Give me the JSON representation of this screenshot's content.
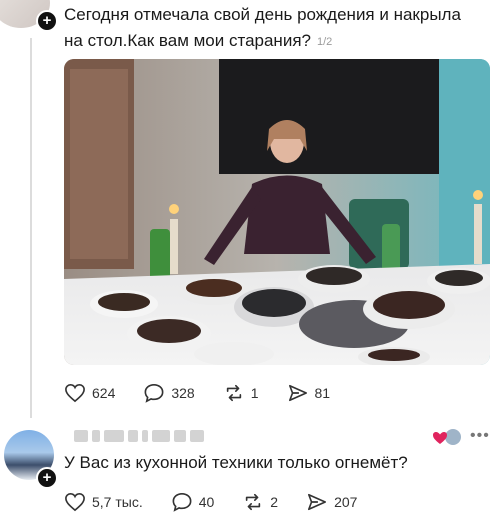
{
  "post": {
    "text": "Сегодня отмечала свой день рождения и накрыла на стол.Как вам мои старания?",
    "page_indicator": "1/2",
    "actions": {
      "likes": "624",
      "comments": "328",
      "reposts": "1",
      "shares": "81"
    }
  },
  "reply": {
    "text": "У Вас из кухонной техники только огнемёт?",
    "actions": {
      "likes": "5,7 тыс.",
      "comments": "40",
      "reposts": "2",
      "shares": "207"
    }
  },
  "icons": {
    "like": "heart-icon",
    "comment": "comment-bubble-icon",
    "repost": "repost-icon",
    "share": "send-icon",
    "follow": "plus-icon",
    "more": "more-dots-icon"
  },
  "colors": {
    "background": "#ffffff",
    "text": "#1a1a1a",
    "muted": "#9a9a9a",
    "liked_heart": "#e0245e"
  }
}
